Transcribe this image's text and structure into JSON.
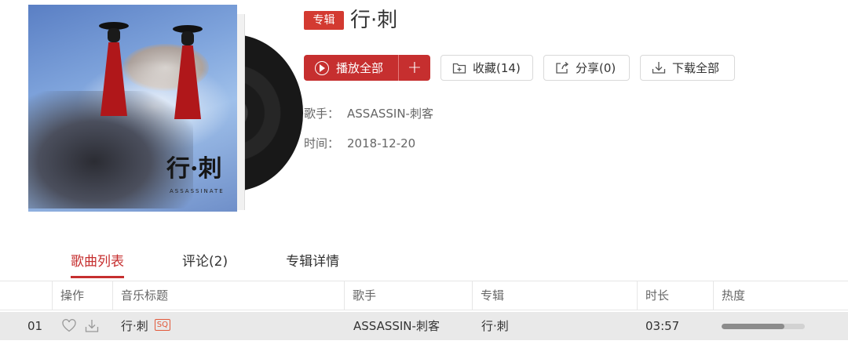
{
  "album": {
    "tag": "专辑",
    "title": "行·刺",
    "cover_title": "行·刺",
    "cover_subtitle": "ASSASSINATE",
    "artist_label": "歌手：",
    "artist": "ASSASSIN-刺客",
    "time_label": "时间：",
    "date": "2018-12-20"
  },
  "actions": {
    "play_all": "播放全部",
    "add": "+",
    "favorite": "收藏(14)",
    "share": "分享(0)",
    "download_all": "下载全部"
  },
  "tabs": [
    {
      "label": "歌曲列表",
      "active": true
    },
    {
      "label": "评论(2)",
      "active": false
    },
    {
      "label": "专辑详情",
      "active": false
    }
  ],
  "table": {
    "columns": [
      "操作",
      "音乐标题",
      "歌手",
      "专辑",
      "时长",
      "热度"
    ],
    "rows": [
      {
        "index": "01",
        "title": "行·刺",
        "quality": "SQ",
        "artist": "ASSASSIN-刺客",
        "album": "行·刺",
        "duration": "03:57",
        "heat": 0.75
      }
    ]
  },
  "colors": {
    "accent": "#c62f2f",
    "tag_bg": "#d33a31",
    "sq_badge": "#e2593a",
    "row_bg": "#e9e9e9"
  },
  "icons": [
    "play-circle-icon",
    "plus-icon",
    "add-folder-icon",
    "share-icon",
    "download-icon",
    "heart-icon",
    "download-icon"
  ]
}
